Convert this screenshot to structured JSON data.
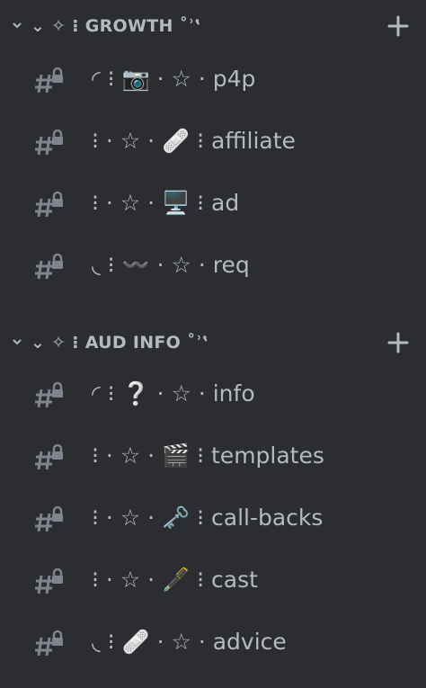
{
  "categories": [
    {
      "title": "⌄ ✧ ⁝ GROWTH ˚ʾ‛",
      "add_icon": "plus-icon",
      "channels": [
        {
          "name": "◜ ⁝ 📷 · ☆ · p4p",
          "icon": "hashtag-lock-icon"
        },
        {
          "name": "⁝ · ☆ · 🩹 ⁝ affiliate",
          "icon": "hashtag-lock-icon"
        },
        {
          "name": "⁝ · ☆ · 🖥️ ⁝ ad",
          "icon": "hashtag-lock-icon"
        },
        {
          "name": "◟ ⁝ 〰️ · ☆ · req",
          "icon": "hashtag-lock-icon"
        }
      ]
    },
    {
      "title": "⌄ ✧ ⁝ AUD INFO ˚ʾ‛",
      "add_icon": "plus-icon",
      "channels": [
        {
          "name": "◜ ⁝ ❔ · ☆ · info",
          "icon": "hashtag-lock-icon"
        },
        {
          "name": "⁝ · ☆ · 🎬 ⁝ templates",
          "icon": "hashtag-lock-icon"
        },
        {
          "name": "⁝ · ☆ · 🗝️ ⁝ call-backs",
          "icon": "hashtag-lock-icon"
        },
        {
          "name": "⁝ · ☆ · 🖋️ ⁝ cast",
          "icon": "hashtag-lock-icon"
        },
        {
          "name": "◟ ⁝ 🩹 · ☆ · advice",
          "icon": "hashtag-lock-icon"
        }
      ]
    }
  ]
}
